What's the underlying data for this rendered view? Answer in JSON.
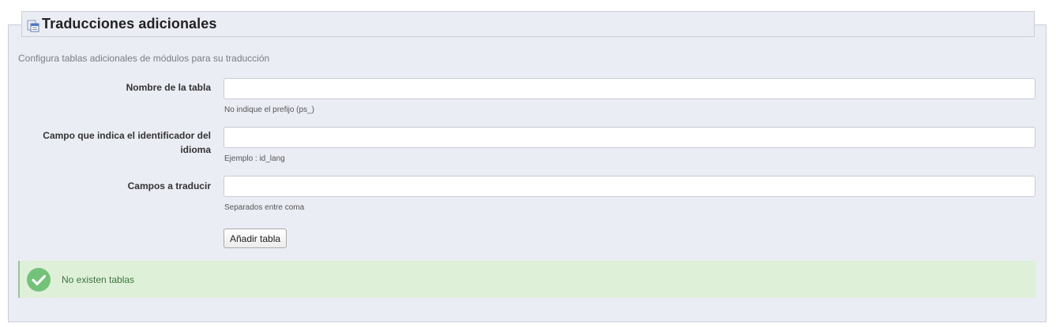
{
  "section": {
    "title": "Traducciones adicionales",
    "title_icon": "translate-table-icon",
    "description": "Configura tablas adicionales de módulos para su traducción"
  },
  "form": {
    "table_name": {
      "label": "Nombre de la tabla",
      "value": "",
      "hint": "No indique el prefijo (ps_)"
    },
    "lang_field": {
      "label_line1": "Campo que indica el identificador del",
      "label_line2": "idioma",
      "value": "",
      "hint": "Ejemplo : id_lang"
    },
    "fields": {
      "label": "Campos a traducir",
      "value": "",
      "hint": "Separados entre coma"
    },
    "submit_label": "Añadir tabla"
  },
  "alert": {
    "icon": "check-circle-icon",
    "text": "No existen tablas",
    "color": "#dff0d8",
    "icon_color": "#72c279"
  }
}
